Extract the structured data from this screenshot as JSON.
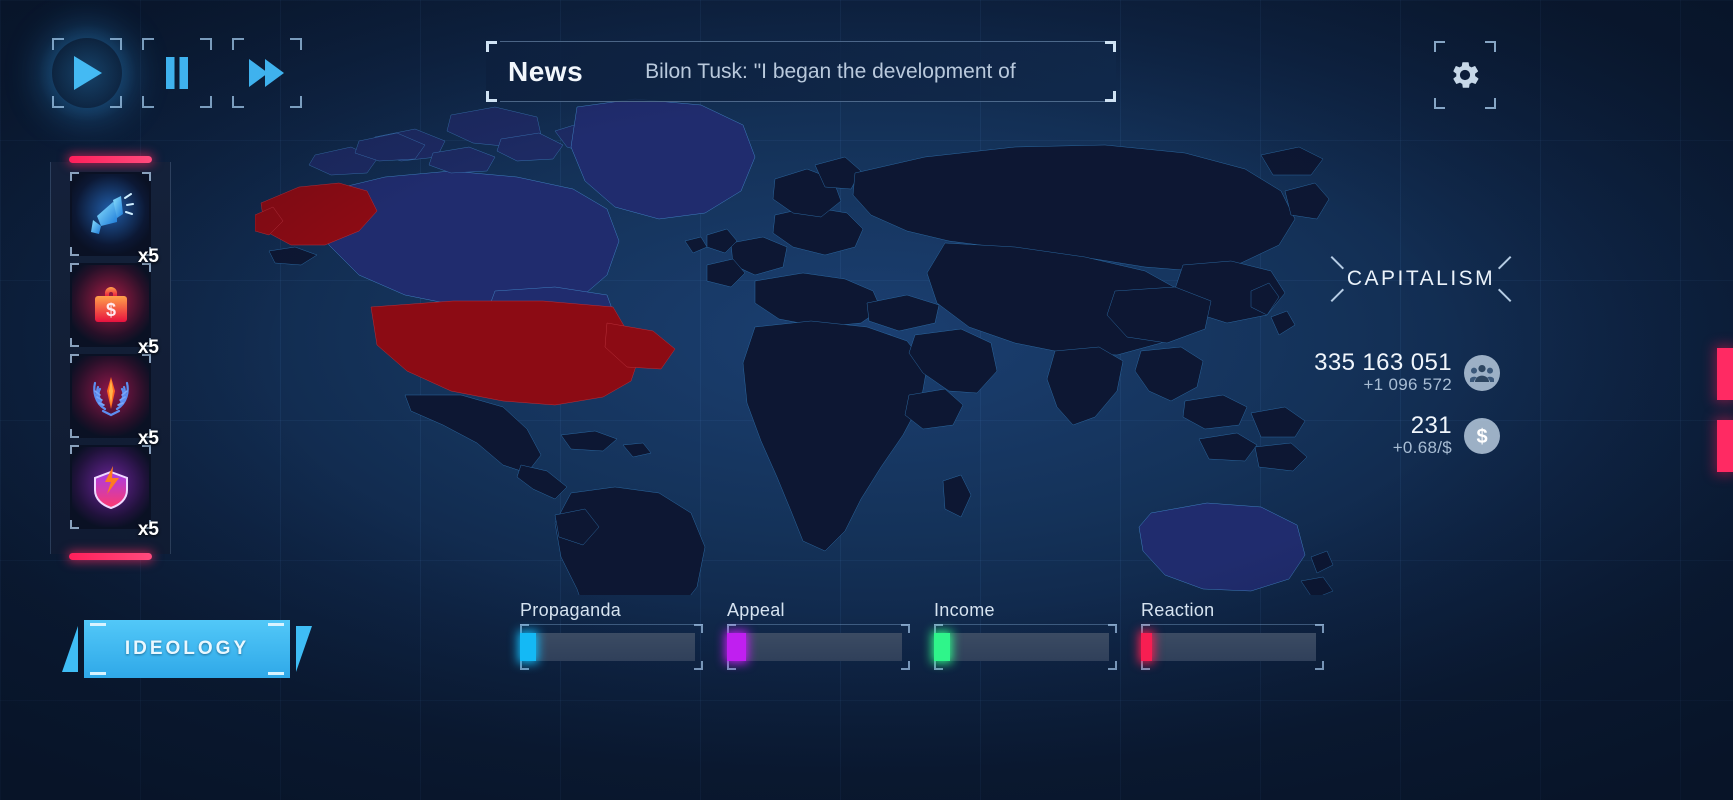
{
  "header": {
    "news_label": "News",
    "news_text": "Bilon Tusk: \"I began the development of",
    "settings_icon": "gear-icon"
  },
  "speed_controls": [
    {
      "name": "play",
      "icon": "play-icon",
      "active": true
    },
    {
      "name": "pause",
      "icon": "pause-icon",
      "active": false
    },
    {
      "name": "fast-forward",
      "icon": "fast-forward-icon",
      "active": false
    }
  ],
  "card_rail": {
    "cards": [
      {
        "name": "propaganda-card",
        "icon": "megaphone-icon",
        "qty": "x5",
        "aura": "aura-blue"
      },
      {
        "name": "funding-card",
        "icon": "money-briefcase-icon",
        "qty": "x5",
        "aura": "aura-red"
      },
      {
        "name": "influence-card",
        "icon": "laurel-wreath-icon",
        "qty": "x5",
        "aura": "aura-rose"
      },
      {
        "name": "defense-card",
        "icon": "shield-bolt-icon",
        "qty": "x5",
        "aura": "aura-violet"
      }
    ]
  },
  "ideology_button": {
    "label": "IDEOLOGY"
  },
  "ideology_name": {
    "label": "CAPITALISM"
  },
  "stats": [
    {
      "name": "population",
      "value": "335 163 051",
      "delta": "+1 096 572",
      "icon": "people-icon"
    },
    {
      "name": "money",
      "value": "231",
      "delta": "+0.68/$",
      "icon": "dollar-icon"
    }
  ],
  "edge_tabs": [
    {
      "name": "edge-tab-1",
      "color": "#ff2a63"
    },
    {
      "name": "edge-tab-2",
      "color": "#ff2a63"
    }
  ],
  "meters": [
    {
      "name": "propaganda",
      "label": "Propaganda",
      "value": 9,
      "color": "#14b9f5"
    },
    {
      "name": "appeal",
      "label": "Appeal",
      "value": 11,
      "color": "#c01ff0"
    },
    {
      "name": "income",
      "label": "Income",
      "value": 9,
      "color": "#2ff58a"
    },
    {
      "name": "reaction",
      "label": "Reaction",
      "value": 6,
      "color": "#f71e52"
    }
  ],
  "map": {
    "colors": {
      "ocean": "#143259",
      "land": "#0d1733",
      "controlled": "#8c0b14",
      "neighbor": "#202c6e"
    },
    "controlled_regions": [
      "United States",
      "Alaska"
    ],
    "neighbor_regions": [
      "Canada",
      "Greenland"
    ]
  }
}
